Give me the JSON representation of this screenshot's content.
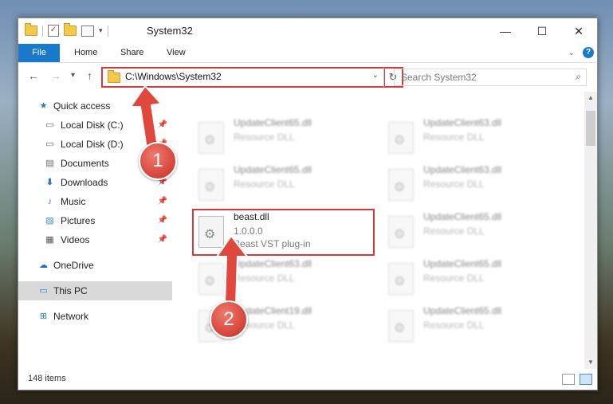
{
  "window": {
    "title": "System32"
  },
  "ribbon": {
    "tabs": [
      "File",
      "Home",
      "Share",
      "View"
    ]
  },
  "address": {
    "path": "C:\\Windows\\System32"
  },
  "search": {
    "placeholder": "Search System32"
  },
  "sidebar": {
    "items": [
      {
        "label": "Quick access",
        "icon": "star-icon",
        "pinned": false
      },
      {
        "label": "Local Disk (C:)",
        "icon": "drive-icon",
        "pinned": true
      },
      {
        "label": "Local Disk (D:)",
        "icon": "drive-icon",
        "pinned": true
      },
      {
        "label": "Documents",
        "icon": "document-icon",
        "pinned": true
      },
      {
        "label": "Downloads",
        "icon": "download-icon",
        "pinned": true
      },
      {
        "label": "Music",
        "icon": "music-icon",
        "pinned": true
      },
      {
        "label": "Pictures",
        "icon": "picture-icon",
        "pinned": true
      },
      {
        "label": "Videos",
        "icon": "video-icon",
        "pinned": true
      },
      {
        "label": "OneDrive",
        "icon": "cloud-icon",
        "pinned": false
      },
      {
        "label": "This PC",
        "icon": "computer-icon",
        "pinned": false,
        "selected": true
      },
      {
        "label": "Network",
        "icon": "network-icon",
        "pinned": false
      }
    ]
  },
  "files": {
    "left": [
      {
        "name": "UpdateClient65.dll",
        "line2": "Resource DLL",
        "blurred": true
      },
      {
        "name": "UpdateClient65.dll",
        "line2": "Resource DLL",
        "blurred": true
      },
      {
        "name": "beast.dll",
        "line2": "1.0.0.0",
        "line3": "Beast VST plug-in",
        "blurred": false,
        "highlighted": true
      },
      {
        "name": "UpdateClient63.dll",
        "line2": "Resource DLL",
        "blurred": true
      },
      {
        "name": "UpdateClient19.dll",
        "line2": "Resource DLL",
        "blurred": true
      }
    ],
    "right": [
      {
        "name": "UpdateClient63.dll",
        "line2": "Resource DLL",
        "blurred": true
      },
      {
        "name": "UpdateClient63.dll",
        "line2": "Resource DLL",
        "blurred": true
      },
      {
        "name": "UpdateClient65.dll",
        "line2": "Resource DLL",
        "blurred": true
      },
      {
        "name": "UpdateClient65.dll",
        "line2": "Resource DLL",
        "blurred": true
      },
      {
        "name": "UpdateClient65.dll",
        "line2": "Resource DLL",
        "blurred": true
      }
    ]
  },
  "status": {
    "count": "148 items"
  },
  "callouts": {
    "step1": "1",
    "step2": "2"
  },
  "colors": {
    "accent": "#1979ca",
    "highlight": "#d43a3a",
    "selection": "#d9d9d9"
  }
}
